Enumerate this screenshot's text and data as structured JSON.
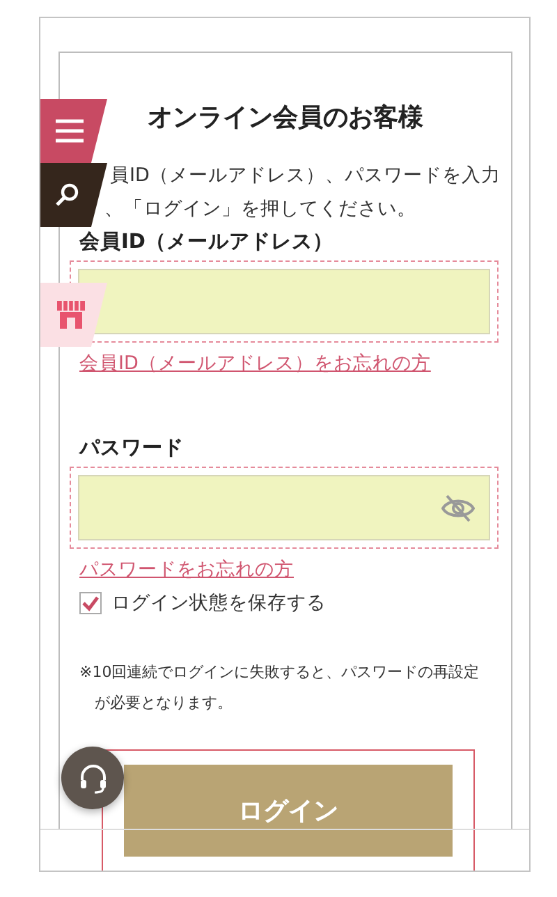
{
  "side_tabs": [
    {
      "kind": "menu"
    },
    {
      "kind": "search"
    },
    {
      "kind": "shop"
    }
  ],
  "title": "オンライン会員のお客様",
  "instructions": [
    "員ID（メールアドレス）、パスワードを入力",
    "、「ログイン」を押してください。"
  ],
  "fields": [
    {
      "kind": "text",
      "label": "会員ID（メールアドレス）",
      "link": "会員ID（メールアドレス）をお忘れの方"
    },
    {
      "kind": "password",
      "label": "パスワード",
      "link": "パスワードをお忘れの方"
    }
  ],
  "remember": {
    "label": "ログイン状態を保存する",
    "checked": true
  },
  "note": [
    "※10回連続でログインに失敗すると、パスワードの再設定",
    "が必要となります。"
  ],
  "login_button": "ログイン"
}
